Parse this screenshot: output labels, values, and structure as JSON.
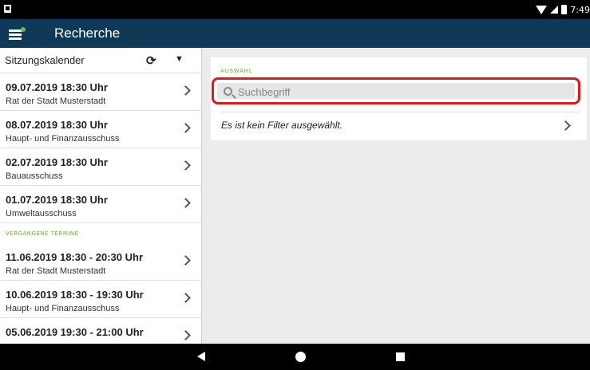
{
  "statusbar": {
    "time": "7:49"
  },
  "appbar": {
    "title": "Recherche"
  },
  "sidebar": {
    "header": "Sitzungskalender",
    "upcoming": [
      {
        "date": "09.07.2019 18:30 Uhr",
        "committee": "Rat der Stadt Musterstadt"
      },
      {
        "date": "08.07.2019 18:30 Uhr",
        "committee": "Haupt- und Finanzausschuss"
      },
      {
        "date": "02.07.2019 18:30 Uhr",
        "committee": "Bauausschuss"
      },
      {
        "date": "01.07.2019 18:30 Uhr",
        "committee": "Umweltausschuss"
      }
    ],
    "past_label": "VERGANGENE TERMINE",
    "past": [
      {
        "date": "11.06.2019 18:30 - 20:30 Uhr",
        "committee": "Rat der Stadt Musterstadt"
      },
      {
        "date": "10.06.2019 18:30 - 19:30 Uhr",
        "committee": "Haupt- und Finanzausschuss"
      },
      {
        "date": "05.06.2019 19:30 - 21:00 Uhr",
        "committee": ""
      }
    ]
  },
  "panel": {
    "section_label": "AUSWAHL",
    "search_placeholder": "Suchbegriff",
    "search_value": "",
    "filter_text": "Es ist kein Filter ausgewählt."
  },
  "icons": {
    "menu": "menu-icon",
    "sync": "sync-icon",
    "filter": "filter-icon",
    "search": "search-icon",
    "chevron": "chevron-right-icon"
  },
  "colors": {
    "appbar": "#0f3a57",
    "accent_green": "#6fae3b",
    "search_highlight": "#e01a1a"
  }
}
